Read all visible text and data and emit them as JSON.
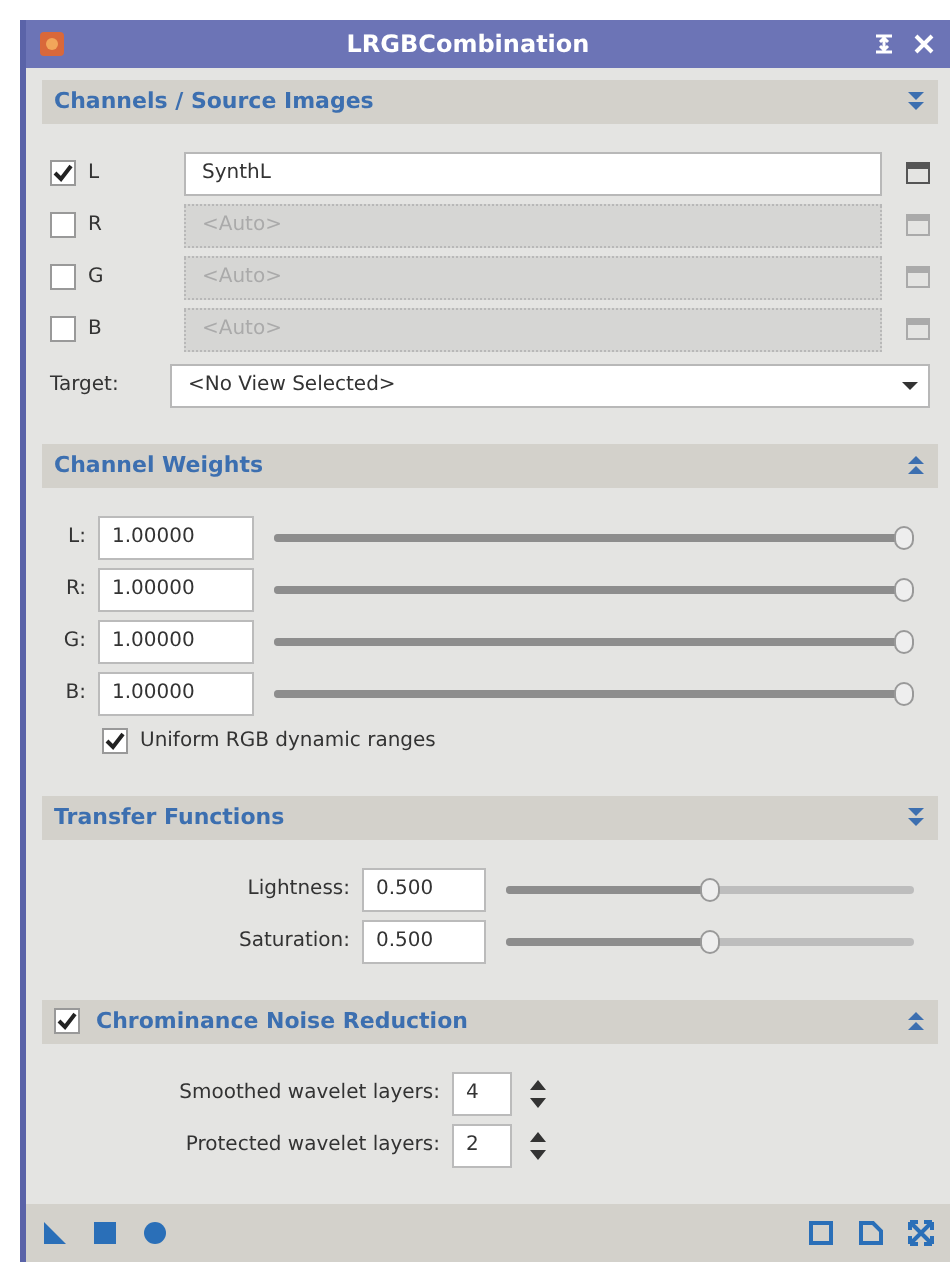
{
  "window": {
    "title": "LRGBCombination"
  },
  "sections": [
    {
      "kind": "channels",
      "title": "Channels / Source Images",
      "toggle_up": false,
      "channels": [
        {
          "label": "L",
          "checked": true,
          "value": "SynthL",
          "disabled": false
        },
        {
          "label": "R",
          "checked": false,
          "placeholder": "<Auto>",
          "disabled": true
        },
        {
          "label": "G",
          "checked": false,
          "placeholder": "<Auto>",
          "disabled": true
        },
        {
          "label": "B",
          "checked": false,
          "placeholder": "<Auto>",
          "disabled": true
        }
      ],
      "target": {
        "label": "Target:",
        "value": "<No View Selected>"
      }
    },
    {
      "kind": "weights",
      "title": "Channel Weights",
      "toggle_up": true,
      "weights": [
        {
          "label": "L:",
          "value": "1.00000",
          "level": 1
        },
        {
          "label": "R:",
          "value": "1.00000",
          "level": 1
        },
        {
          "label": "G:",
          "value": "1.00000",
          "level": 1
        },
        {
          "label": "B:",
          "value": "1.00000",
          "level": 1
        }
      ],
      "option": {
        "label": "Uniform RGB dynamic ranges",
        "checked": true
      }
    },
    {
      "kind": "transfer",
      "title": "Transfer Functions",
      "toggle_up": false,
      "params": [
        {
          "label": "Lightness:",
          "value": "0.500",
          "level": 0.5
        },
        {
          "label": "Saturation:",
          "value": "0.500",
          "level": 0.5
        }
      ]
    },
    {
      "kind": "noise",
      "title": "Chrominance Noise Reduction",
      "toggle_up": true,
      "checked": true,
      "spins": [
        {
          "label": "Smoothed wavelet layers:",
          "value": "4"
        },
        {
          "label": "Protected wavelet layers:",
          "value": "2"
        }
      ]
    }
  ]
}
